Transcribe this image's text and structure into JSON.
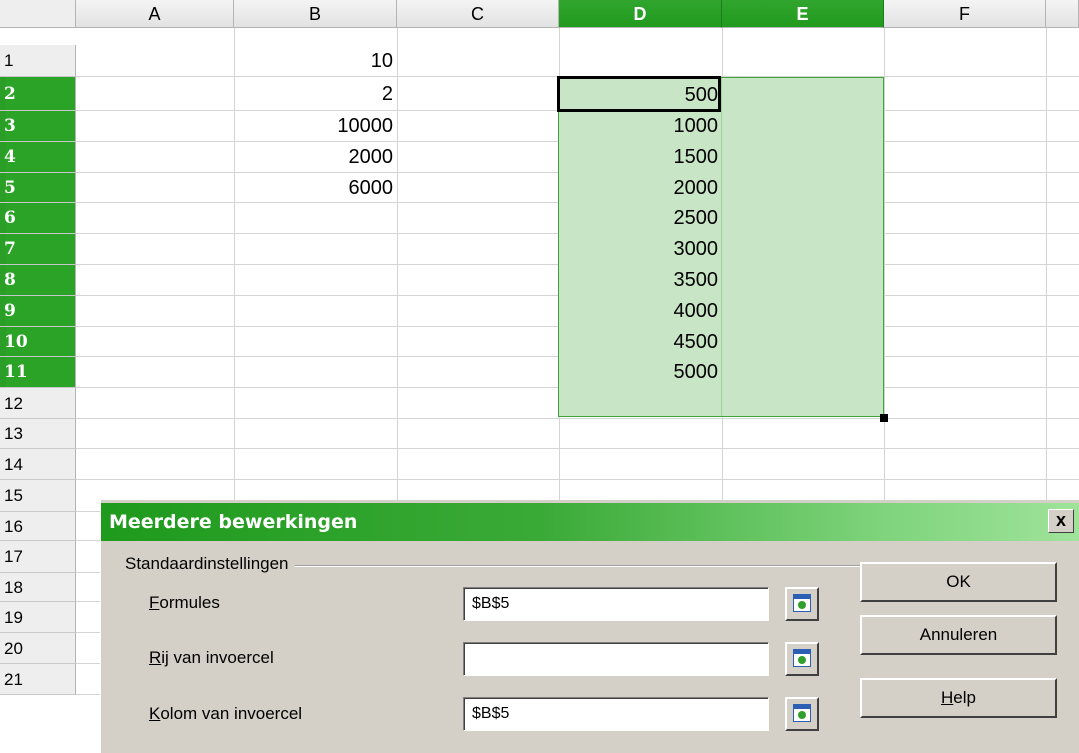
{
  "columns": [
    "A",
    "B",
    "C",
    "D",
    "E",
    "F"
  ],
  "rows": [
    "1",
    "2",
    "3",
    "4",
    "5",
    "6",
    "7",
    "8",
    "9",
    "10",
    "11",
    "12",
    "13",
    "14",
    "15",
    "16",
    "17",
    "18",
    "19",
    "20",
    "21"
  ],
  "cells": {
    "B1": "10",
    "B2": "2",
    "B3": "10000",
    "B4": "2000",
    "B5": "6000",
    "D2": "500",
    "D3": "1000",
    "D4": "1500",
    "D5": "2000",
    "D6": "2500",
    "D7": "3000",
    "D8": "3500",
    "D9": "4000",
    "D10": "4500",
    "D11": "5000"
  },
  "selection": {
    "range": "D2:E11",
    "active_cell": "D2"
  },
  "colors": {
    "selection_fill": "#c8e6c6",
    "header_selected": "#2aa327",
    "title_bar": "#1e9a1c"
  },
  "dialog": {
    "title": "Meerdere bewerkingen",
    "close_glyph": "x",
    "group_label": "Standaardinstellingen",
    "fields": [
      {
        "mnemonic": "F",
        "label_rest": "ormules",
        "value": "$B$5"
      },
      {
        "mnemonic": "R",
        "label_rest": "ij van invoercel",
        "value": ""
      },
      {
        "mnemonic": "K",
        "label_rest": "olom van invoercel",
        "value": "$B$5"
      }
    ],
    "buttons": {
      "ok": "OK",
      "cancel": "Annuleren",
      "help_mnemonic": "H",
      "help_rest": "elp"
    }
  }
}
